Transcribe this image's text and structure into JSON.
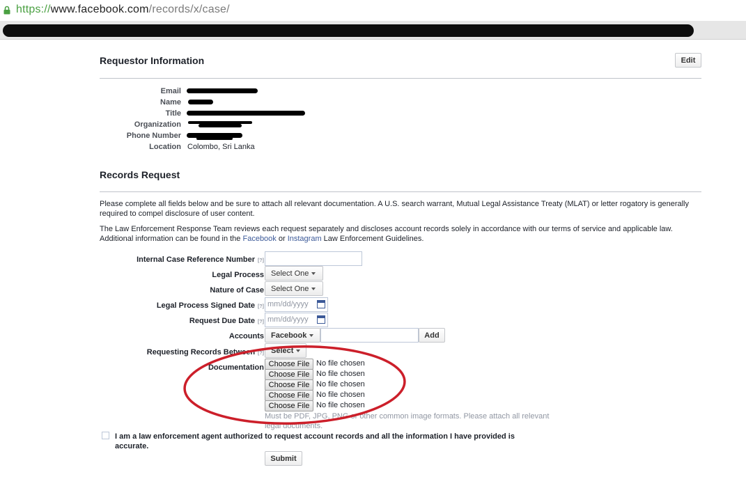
{
  "browser": {
    "url_scheme": "https://",
    "url_host": "www.facebook.com",
    "url_path": "/records/x/case/",
    "lock_icon": "lock-icon"
  },
  "requestor": {
    "title": "Requestor Information",
    "edit_label": "Edit",
    "fields": [
      {
        "label": "Email",
        "value": ""
      },
      {
        "label": "Name",
        "value": ""
      },
      {
        "label": "Title",
        "value": ""
      },
      {
        "label": "Organization",
        "value": ""
      },
      {
        "label": "Phone Number",
        "value": ""
      },
      {
        "label": "Location",
        "value": "Colombo, Sri Lanka"
      }
    ]
  },
  "records": {
    "title": "Records Request",
    "para1": "Please complete all fields below and be sure to attach all relevant documentation. A U.S. search warrant, Mutual Legal Assistance Treaty (MLAT) or letter rogatory is generally required to compel disclosure of user content.",
    "para2_start": "The Law Enforcement Response Team reviews each request separately and discloses account records solely in accordance with our terms of service and applicable law. Additional information can be found in the ",
    "para2_link1": "Facebook",
    "para2_mid": " or ",
    "para2_link2": "Instagram",
    "para2_end": " Law Enforcement Guidelines."
  },
  "form": {
    "help_marker": "[?]",
    "case_ref_label": "Internal Case Reference Number",
    "legal_process_label": "Legal Process",
    "legal_process_value": "Select One",
    "nature_label": "Nature of Case",
    "nature_value": "Select One",
    "signed_date_label": "Legal Process Signed Date",
    "due_date_label": "Request Due Date",
    "date_placeholder": "mm/dd/yyyy",
    "accounts_label": "Accounts",
    "accounts_platform": "Facebook",
    "add_label": "Add",
    "between_label": "Requesting Records Between",
    "between_value": "Select",
    "documentation_label": "Documentation",
    "choose_file_label": "Choose File",
    "no_file_label": "No file chosen",
    "hint": "Must be PDF, JPG, PNG or other common image formats. Please attach all relevant legal documents.",
    "agree_text": "I am a law enforcement agent authorized to request account records and all the information I have provided is accurate.",
    "submit_label": "Submit"
  },
  "colors": {
    "accent": "#3b5998",
    "annotation": "#cc1f2a"
  }
}
